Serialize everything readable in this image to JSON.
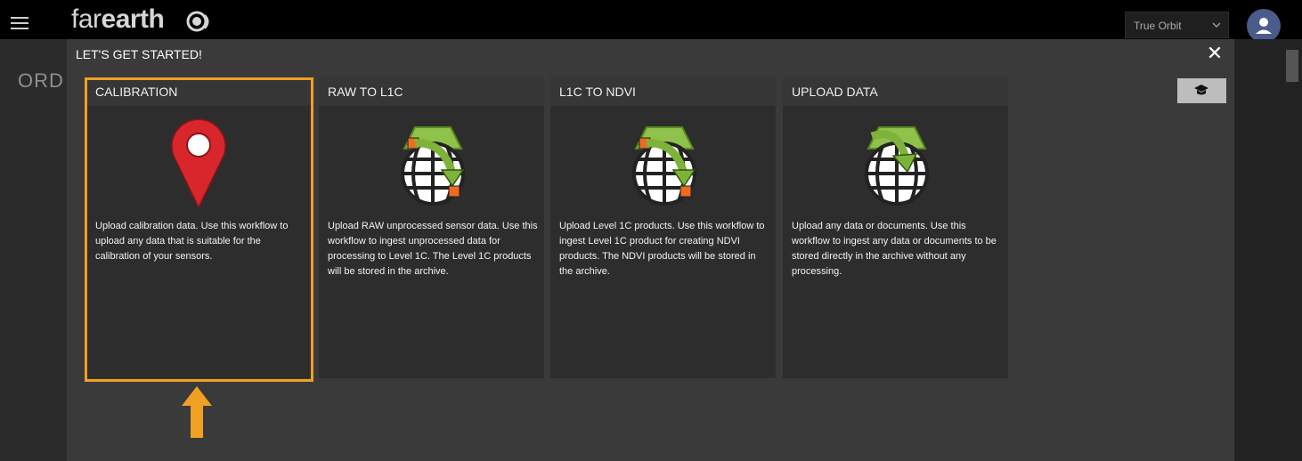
{
  "header": {
    "logo_far": "far",
    "logo_earth": "earth",
    "org_selected": "True Orbit"
  },
  "background": {
    "partial_text": "ORD"
  },
  "modal": {
    "title": "LET'S GET STARTED!",
    "close_symbol": "✕",
    "cards": [
      {
        "title": "CALIBRATION",
        "icon": "map-pin-icon",
        "description": "Upload calibration data. Use this workflow to upload any data that is suitable for the calibration of your sensors."
      },
      {
        "title": "RAW TO L1C",
        "icon": "globe-transform-icon",
        "description": "Upload RAW unprocessed sensor data. Use this workflow to ingest unprocessed data for processing to Level 1C. The Level 1C products will be stored in the archive."
      },
      {
        "title": "L1C TO NDVI",
        "icon": "globe-transform-icon",
        "description": "Upload Level 1C products. Use this workflow to ingest Level 1C product for creating NDVI products. The NDVI products will be stored in the archive."
      },
      {
        "title": "UPLOAD DATA",
        "icon": "globe-upload-icon",
        "description": "Upload any data or documents. Use this workflow to ingest any data or documents to be stored directly in the archive without any processing."
      }
    ]
  },
  "colors": {
    "highlight": "#f0a022",
    "pin_red": "#d8262c",
    "globe_green": "#7fb23a"
  }
}
